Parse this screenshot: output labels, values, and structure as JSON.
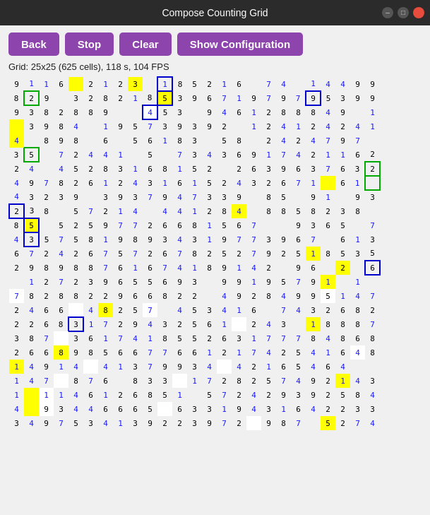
{
  "titlebar": {
    "title": "Compose Counting Grid",
    "min_label": "–",
    "max_label": "□",
    "close_label": "×"
  },
  "toolbar": {
    "back_label": "Back",
    "stop_label": "Stop",
    "clear_label": "Clear",
    "config_label": "Show Configuration"
  },
  "info": {
    "text": "Grid: 25x25 (625 cells), 118 s, 104 FPS"
  },
  "grid": {
    "rows": [
      [
        "9",
        "1",
        "1",
        "6",
        "",
        "2",
        "1",
        "2",
        "3",
        "",
        "1",
        "8",
        "5",
        "2",
        "1",
        "6",
        "",
        "7",
        "4",
        "",
        "1",
        "4",
        "4",
        "9",
        "9"
      ],
      [
        "8",
        "2",
        "9",
        "",
        "3",
        "2",
        "8",
        "2",
        "1",
        "8",
        "5",
        "3",
        "9",
        "6",
        "7",
        "1",
        "9",
        "7",
        "9",
        "7",
        "9",
        "5",
        "3",
        "9",
        "9"
      ],
      [
        "9",
        "3",
        "8",
        "2",
        "8",
        "8",
        "9",
        "",
        "",
        "4",
        "5",
        "3",
        "",
        "9",
        "4",
        "6",
        "1",
        "2",
        "8",
        "8",
        "8",
        "4",
        "9",
        "",
        "1"
      ],
      [
        "",
        "3",
        "9",
        "8",
        "4",
        "",
        "1",
        "9",
        "5",
        "7",
        "3",
        "9",
        "3",
        "9",
        "2",
        "",
        "1",
        "2",
        "4",
        "1",
        "2",
        "4",
        "2",
        "4",
        "1"
      ],
      [
        "4",
        "",
        "8",
        "9",
        "8",
        "",
        "6",
        "",
        "5",
        "6",
        "1",
        "8",
        "3",
        "",
        "5",
        "8",
        "",
        "2",
        "4",
        "2",
        "4",
        "7",
        "9",
        "7"
      ],
      [
        "3",
        "5",
        "",
        "7",
        "2",
        "4",
        "4",
        "1",
        "",
        "5",
        "",
        "7",
        "3",
        "4",
        "3",
        "6",
        "9",
        "1",
        "7",
        "4",
        "2",
        "1",
        "1",
        "6",
        "2"
      ],
      [
        "2",
        "4",
        "",
        "4",
        "5",
        "2",
        "8",
        "3",
        "1",
        "6",
        "8",
        "1",
        "5",
        "2",
        "",
        "2",
        "6",
        "3",
        "9",
        "6",
        "3",
        "7",
        "6",
        "3",
        "2"
      ],
      [
        "4",
        "9",
        "7",
        "8",
        "2",
        "6",
        "1",
        "2",
        "4",
        "3",
        "1",
        "6",
        "1",
        "5",
        "2",
        "4",
        "3",
        "2",
        "6",
        "7",
        "1",
        "",
        "6",
        "1",
        ""
      ],
      [
        "4",
        "3",
        "2",
        "3",
        "9",
        "",
        "3",
        "9",
        "3",
        "7",
        "9",
        "4",
        "7",
        "3",
        "3",
        "9",
        "",
        "8",
        "5",
        "",
        "9",
        "1",
        "",
        "9",
        "3"
      ],
      [
        "2",
        "3",
        "8",
        "",
        "5",
        "7",
        "2",
        "1",
        "4",
        "",
        "4",
        "4",
        "1",
        "2",
        "8",
        "4",
        "",
        "8",
        "8",
        "5",
        "8",
        "2",
        "3",
        "8"
      ],
      [
        "8",
        "5",
        "",
        "5",
        "2",
        "5",
        "9",
        "7",
        "7",
        "2",
        "6",
        "6",
        "8",
        "1",
        "5",
        "6",
        "7",
        "",
        "",
        "9",
        "3",
        "6",
        "5",
        "",
        "7"
      ],
      [
        "4",
        "3",
        "5",
        "7",
        "5",
        "8",
        "1",
        "9",
        "8",
        "9",
        "3",
        "4",
        "3",
        "1",
        "9",
        "7",
        "7",
        "3",
        "9",
        "6",
        "7",
        "",
        "6",
        "1",
        "3"
      ],
      [
        "6",
        "7",
        "2",
        "4",
        "2",
        "6",
        "7",
        "5",
        "7",
        "2",
        "6",
        "7",
        "8",
        "2",
        "5",
        "2",
        "7",
        "9",
        "2",
        "5",
        "1",
        "8",
        "5",
        "3",
        "5"
      ],
      [
        "2",
        "9",
        "8",
        "9",
        "8",
        "8",
        "7",
        "6",
        "1",
        "6",
        "7",
        "4",
        "1",
        "8",
        "9",
        "1",
        "4",
        "2",
        "",
        "9",
        "6",
        "",
        "2",
        "",
        "6"
      ],
      [
        "",
        "1",
        "2",
        "7",
        "2",
        "3",
        "9",
        "6",
        "5",
        "5",
        "6",
        "9",
        "3",
        "",
        "9",
        "9",
        "1",
        "9",
        "5",
        "7",
        "9",
        "1",
        "",
        "1"
      ],
      [
        "7",
        "8",
        "2",
        "8",
        "8",
        "2",
        "2",
        "9",
        "6",
        "6",
        "8",
        "2",
        "2",
        "",
        "4",
        "9",
        "2",
        "8",
        "4",
        "9",
        "9",
        "5",
        "1",
        "4",
        "7"
      ],
      [
        "2",
        "4",
        "6",
        "6",
        "",
        "4",
        "8",
        "2",
        "5",
        "7",
        "",
        "4",
        "5",
        "3",
        "4",
        "1",
        "6",
        "",
        "7",
        "4",
        "3",
        "2",
        "6",
        "8",
        "2"
      ],
      [
        "2",
        "2",
        "6",
        "8",
        "3",
        "1",
        "7",
        "2",
        "9",
        "4",
        "3",
        "2",
        "5",
        "6",
        "1",
        "",
        "2",
        "4",
        "3",
        "",
        "1",
        "8",
        "8",
        "8",
        "7"
      ],
      [
        "3",
        "8",
        "7",
        "",
        "3",
        "6",
        "1",
        "7",
        "4",
        "1",
        "8",
        "5",
        "5",
        "2",
        "6",
        "3",
        "1",
        "7",
        "7",
        "7",
        "8",
        "4",
        "8",
        "6",
        "8"
      ],
      [
        "2",
        "6",
        "6",
        "8",
        "9",
        "8",
        "5",
        "6",
        "6",
        "7",
        "7",
        "6",
        "6",
        "1",
        "2",
        "1",
        "7",
        "4",
        "2",
        "5",
        "4",
        "1",
        "6",
        "4",
        "8"
      ],
      [
        "1",
        "4",
        "9",
        "1",
        "4",
        "",
        "4",
        "1",
        "3",
        "7",
        "9",
        "9",
        "3",
        "4",
        "",
        "4",
        "2",
        "1",
        "6",
        "5",
        "4",
        "6",
        "4"
      ],
      [
        "1",
        "4",
        "7",
        "",
        "8",
        "7",
        "6",
        "",
        "8",
        "3",
        "3",
        "",
        "1",
        "7",
        "2",
        "8",
        "2",
        "5",
        "7",
        "4",
        "9",
        "2",
        "1",
        "4",
        "3"
      ],
      [
        "1",
        "",
        "1",
        "1",
        "4",
        "6",
        "1",
        "2",
        "6",
        "8",
        "5",
        "1",
        "",
        "5",
        "7",
        "2",
        "4",
        "2",
        "9",
        "3",
        "9",
        "2",
        "5",
        "8",
        "4"
      ],
      [
        "4",
        "",
        "9",
        "3",
        "4",
        "4",
        "6",
        "6",
        "6",
        "5",
        "",
        "6",
        "3",
        "3",
        "1",
        "9",
        "4",
        "3",
        "1",
        "6",
        "4",
        "2",
        "2",
        "3",
        "3"
      ],
      [
        "3",
        "4",
        "9",
        "7",
        "5",
        "3",
        "4",
        "1",
        "3",
        "9",
        "2",
        "2",
        "3",
        "9",
        "7",
        "2",
        "",
        "9",
        "8",
        "7",
        "",
        "5",
        "2",
        "7",
        "4"
      ]
    ]
  }
}
